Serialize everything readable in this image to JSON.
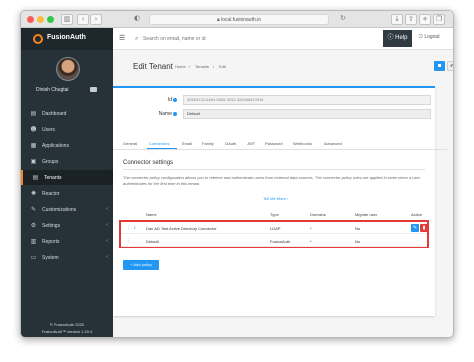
{
  "browser": {
    "url": "local.fusionauth.io",
    "colors": {
      "close": "#fc5c57",
      "minimize": "#fdbc40",
      "maximize": "#34c749"
    }
  },
  "sidebar": {
    "brand": "FusionAuth",
    "user_name": "Dinish Chugtai",
    "items": [
      {
        "icon": "dashboard-icon",
        "glyph": "▤",
        "label": "Dashboard",
        "caret": ""
      },
      {
        "icon": "users-icon",
        "glyph": "☻",
        "label": "Users",
        "caret": ""
      },
      {
        "icon": "applications-icon",
        "glyph": "▦",
        "label": "Applications",
        "caret": ""
      },
      {
        "icon": "groups-icon",
        "glyph": "▣",
        "label": "Groups",
        "caret": ""
      },
      {
        "icon": "tenants-icon",
        "glyph": "▤",
        "label": "Tenants",
        "caret": ""
      },
      {
        "icon": "reactor-icon",
        "glyph": "✺",
        "label": "Reactor",
        "caret": ""
      },
      {
        "icon": "customizations-icon",
        "glyph": "✎",
        "label": "Customizations",
        "caret": "‹"
      },
      {
        "icon": "settings-icon",
        "glyph": "⚙",
        "label": "Settings",
        "caret": "‹"
      },
      {
        "icon": "reports-icon",
        "glyph": "▥",
        "label": "Reports",
        "caret": "‹"
      },
      {
        "icon": "system-icon",
        "glyph": "▭",
        "label": "System",
        "caret": "‹"
      }
    ],
    "active_item": "Tenants",
    "footer_copyright": "© FusionAuth 2020",
    "footer_version": "FusionAuth™ version 1.19.4"
  },
  "topbar": {
    "search_placeholder": "Search on email, name or id",
    "help_label": "Help",
    "logout_label": "Logout"
  },
  "page": {
    "title": "Edit Tenant",
    "breadcrumbs": [
      "Home",
      "/",
      "Tenants",
      "/",
      "Edit"
    ],
    "save_glyph": "▪",
    "back_glyph": "↶"
  },
  "form": {
    "id_label": "Id",
    "id_value": "30663132-6464-6665-3032-326466613934",
    "name_label": "Name",
    "name_value": "Default"
  },
  "tabs": [
    "General",
    "Connectors",
    "Email",
    "Family",
    "OAuth",
    "JWT",
    "Password",
    "Webhooks",
    "Advanced"
  ],
  "active_tab": "Connectors",
  "connectors": {
    "title": "Connector settings",
    "description": "The connector policy configuration allows you to retrieve and authenticate users from external data sources. The connector policy rules are applied in order when a user authenticates for the first time in this tenant.",
    "tell_more": "Tell Me More ›",
    "columns": [
      "Name",
      "Type",
      "Domains",
      "Migrate user",
      "Action"
    ],
    "rows": [
      {
        "name": "Dan AD Test Active Directory Connector",
        "type": "LDAP",
        "domains": "*",
        "migrate": "No"
      },
      {
        "name": "Default",
        "type": "FusionAuth",
        "domains": "*",
        "migrate": "No"
      }
    ],
    "add_button": "+ Add policy"
  },
  "colors": {
    "sidebar_bg": "#263238",
    "accent": "#2196f3",
    "brand_orange": "#f58320",
    "highlight_red": "#e53935",
    "delete_red": "#e53935"
  }
}
